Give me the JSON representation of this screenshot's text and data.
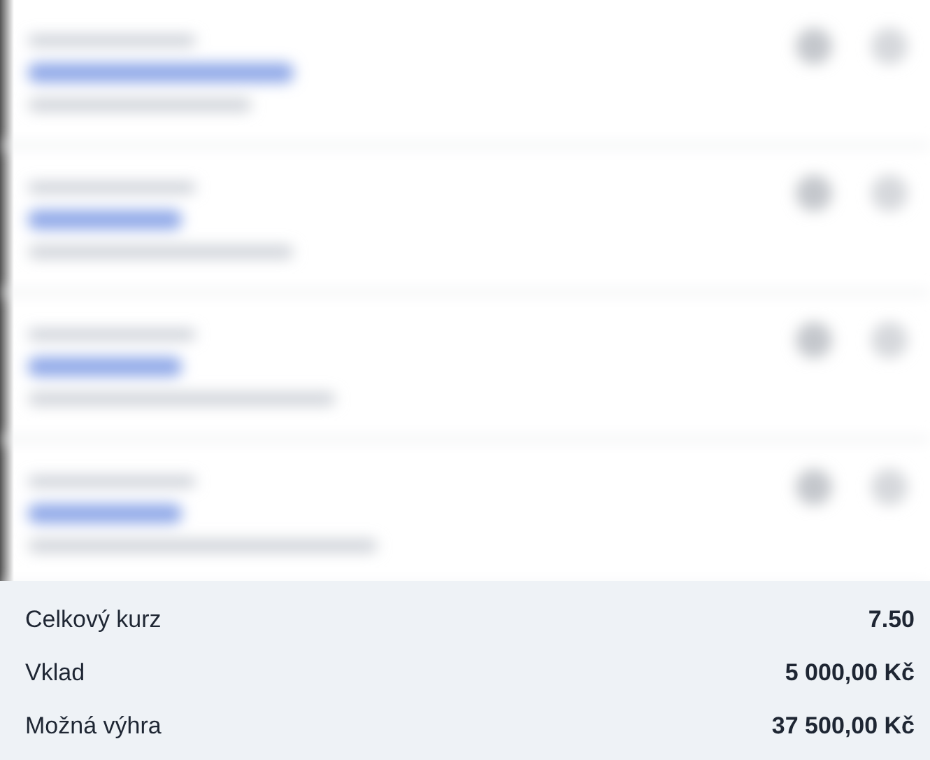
{
  "summary": [
    {
      "label": "Celkový kurz",
      "value": "7.50"
    },
    {
      "label": "Vklad",
      "value": "5 000,00 Kč"
    },
    {
      "label": "Možná výhra",
      "value": "37 500,00 Kč"
    }
  ]
}
